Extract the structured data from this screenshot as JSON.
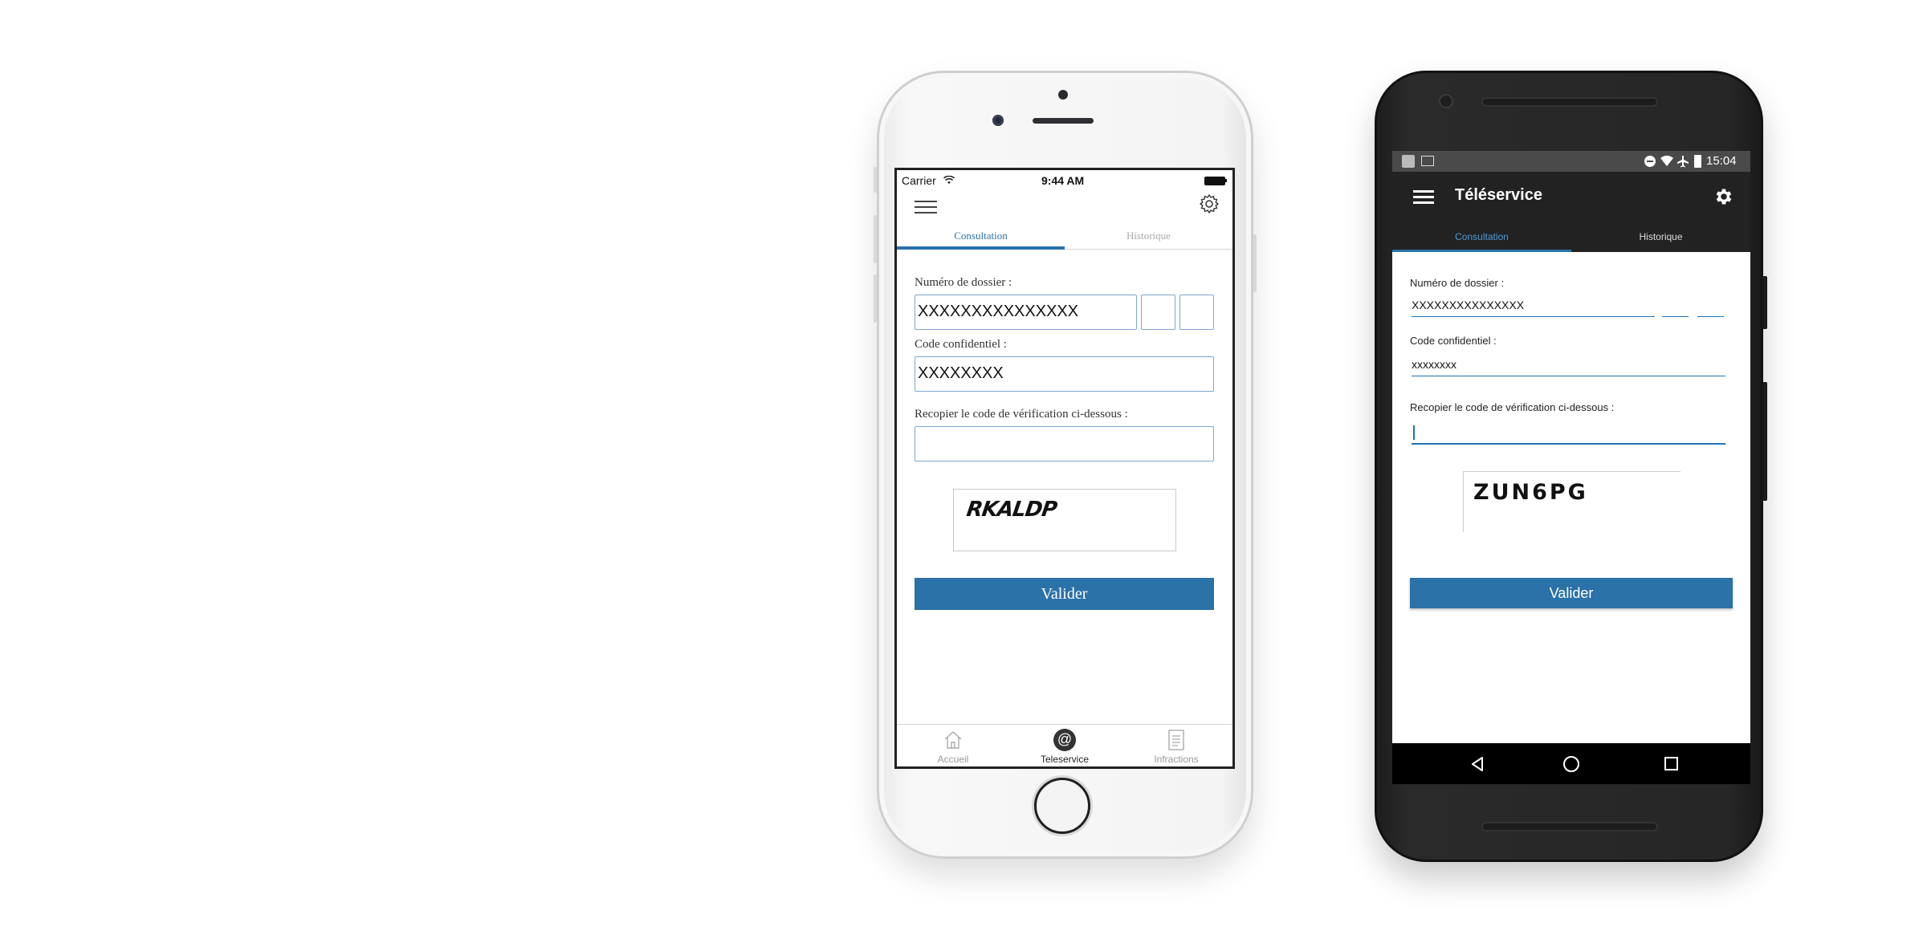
{
  "iphone": {
    "status": {
      "carrier": "Carrier",
      "time": "9:44 AM"
    },
    "tabs": [
      {
        "label": "Consultation",
        "active": true
      },
      {
        "label": "Historique",
        "active": false
      }
    ],
    "form": {
      "dossier_label": "Numéro de dossier :",
      "dossier_value": "XXXXXXXXXXXXXXX",
      "code_label": "Code confidentiel :",
      "code_value": "XXXXXXXX",
      "verif_label": "Recopier le code de vérification ci-dessous :",
      "verif_value": "",
      "captcha_text": "RKALDP",
      "submit_label": "Valider"
    },
    "bottom_nav": [
      {
        "label": "Accueil",
        "icon": "home-icon",
        "active": false
      },
      {
        "label": "Teleservice",
        "icon": "at-icon",
        "active": true
      },
      {
        "label": "Infractions",
        "icon": "document-icon",
        "active": false
      }
    ]
  },
  "android": {
    "status": {
      "time": "15:04"
    },
    "appbar": {
      "title": "Téléservice"
    },
    "tabs": [
      {
        "label": "Consultation",
        "active": true
      },
      {
        "label": "Historique",
        "active": false
      }
    ],
    "form": {
      "dossier_label": "Numéro de dossier :",
      "dossier_value": "XXXXXXXXXXXXXXX",
      "code_label": "Code confidentiel :",
      "code_value": "xxxxxxxx",
      "verif_label": "Recopier le code de vérification ci-dessous :",
      "verif_value": "",
      "captcha_text": "ZUN6PG",
      "submit_label": "Valider"
    }
  },
  "colors": {
    "accent": "#2a72a8",
    "android_bar": "#222222",
    "input_border": "#7ea6d4"
  }
}
